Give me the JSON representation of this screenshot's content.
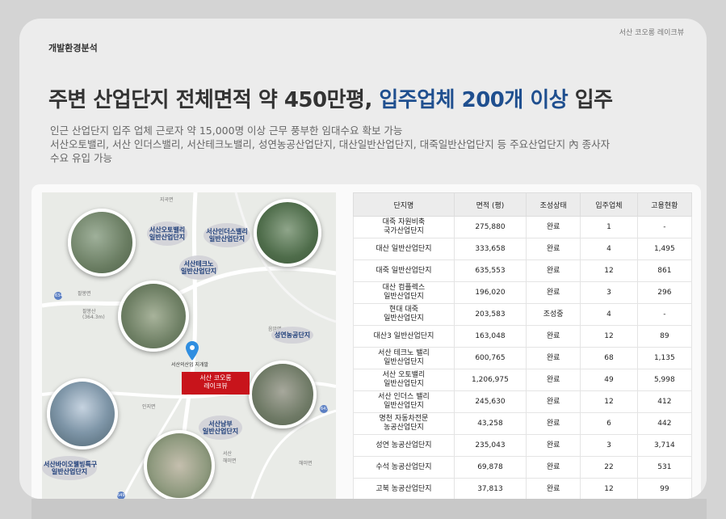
{
  "brand": "서산 코오롱 레이크뷰",
  "section_label": "개발환경분석",
  "headline": {
    "prefix": "주변 산업단지 전체면적 약 450만평, ",
    "highlight": "입주업체 200개 이상",
    "suffix": " 입주"
  },
  "description": {
    "line1": "인근 산업단지 입주 업체 근로자 약 15,000명 이상 근무 풍부한 임대수요 확보 가능",
    "line2": "서산오토밸리, 서산 인더스밸리, 서산테크노밸리, 성연농공산업단지, 대산일반산업단지, 대죽일반산업단지 등 주요산업단지 內 종사자",
    "line3": "수요 유입 가능"
  },
  "map": {
    "site_label": "서산 코오롱\n레이크뷰",
    "site_address": "서산의산업 지개발",
    "place_labels": {
      "p1": "서산오토밸리\n일반산업단지",
      "p2": "서산인더스밸리\n일반산업단지",
      "p3": "서산테크노\n일반산업단지",
      "p4": "성연농공단지",
      "p5": "서산남부\n일반산업단지",
      "p6": "서산바이오웰빙특구\n일반산업단지"
    },
    "map_texts": {
      "t1": "지곡면",
      "t2": "팔봉면",
      "t3": "팔봉산\n(364.3m)",
      "t4": "인지면",
      "t5": "음암면",
      "t6": "해미면",
      "t7": "서산\n해미면"
    },
    "road_numbers": {
      "r1": "634",
      "r2": "29",
      "r3": "647",
      "r4": "649"
    }
  },
  "table": {
    "headers": [
      "단지명",
      "면적 (평)",
      "조성상태",
      "입주업체",
      "고용현황"
    ],
    "rows": [
      {
        "name": "대죽 자원비축\n국가산업단지",
        "area": "275,880",
        "status": "완료",
        "companies": "1",
        "employment": "-"
      },
      {
        "name": "대산 일반산업단지",
        "area": "333,658",
        "status": "완료",
        "companies": "4",
        "employment": "1,495"
      },
      {
        "name": "대죽 일반산업단지",
        "area": "635,553",
        "status": "완료",
        "companies": "12",
        "employment": "861"
      },
      {
        "name": "대산 컴플렉스\n일반산업단지",
        "area": "196,020",
        "status": "완료",
        "companies": "3",
        "employment": "296"
      },
      {
        "name": "현대 대죽\n일반산업단지",
        "area": "203,583",
        "status": "조성중",
        "companies": "4",
        "employment": "-"
      },
      {
        "name": "대산3 일반산업단지",
        "area": "163,048",
        "status": "완료",
        "companies": "12",
        "employment": "89"
      },
      {
        "name": "서산 테크노 밸리\n일반산업단지",
        "area": "600,765",
        "status": "완료",
        "companies": "68",
        "employment": "1,135"
      },
      {
        "name": "서산 오토밸리\n일반산업단지",
        "area": "1,206,975",
        "status": "완료",
        "companies": "49",
        "employment": "5,998"
      },
      {
        "name": "서산 인더스 밸리\n일반산업단지",
        "area": "245,630",
        "status": "완료",
        "companies": "12",
        "employment": "412"
      },
      {
        "name": "명천 자동차전문\n농공산업단지",
        "area": "43,258",
        "status": "완료",
        "companies": "6",
        "employment": "442"
      },
      {
        "name": "성연 농공산업단지",
        "area": "235,043",
        "status": "완료",
        "companies": "3",
        "employment": "3,714"
      },
      {
        "name": "수석 농공산업단지",
        "area": "69,878",
        "status": "완료",
        "companies": "22",
        "employment": "531"
      },
      {
        "name": "고북 농공산업단지",
        "area": "37,813",
        "status": "완료",
        "companies": "12",
        "employment": "99"
      }
    ]
  },
  "colors": {
    "accent": "#1f4f8f",
    "site_marker": "#c8141b",
    "pin": "#2f8ee0"
  }
}
